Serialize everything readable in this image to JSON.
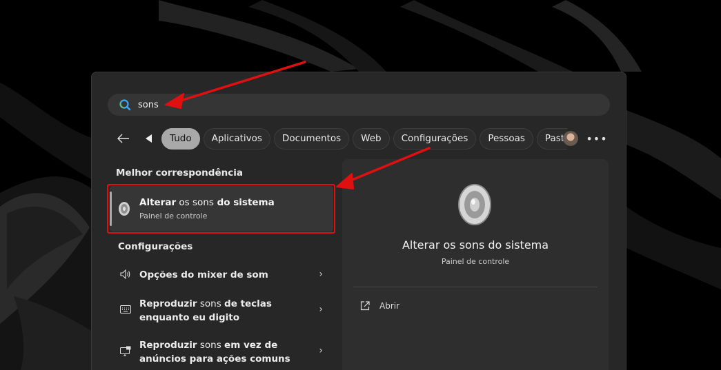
{
  "search": {
    "query": "sons",
    "icon": "search-icon"
  },
  "filters": {
    "chips": [
      "Tudo",
      "Aplicativos",
      "Documentos",
      "Web",
      "Configurações",
      "Pessoas",
      "Pasta"
    ],
    "active": "Tudo"
  },
  "best_match": {
    "heading": "Melhor correspondência",
    "title_bold_1": "Alterar",
    "title_regular_1": " os ",
    "title_regular_2": "sons",
    "title_bold_2": " do sistema",
    "subtitle": "Painel de controle",
    "icon": "speaker-icon"
  },
  "settings": {
    "heading": "Configurações",
    "items": [
      {
        "label": "Opções do mixer de som",
        "icon": "volume-icon"
      },
      {
        "label_a": "Reproduzir",
        "label_b": " sons ",
        "label_c": "de teclas",
        "label_d": "enquanto eu digito",
        "icon": "keyboard-icon"
      },
      {
        "label_a": "Reproduzir",
        "label_b": " sons ",
        "label_c": "em vez de",
        "label_d": "anúncios para ações comuns",
        "icon": "monitor-icon"
      }
    ]
  },
  "detail": {
    "title": "Alterar os sons do sistema",
    "subtitle": "Painel de controle",
    "open_label": "Abrir",
    "icon": "speaker-icon"
  },
  "colors": {
    "highlight": "#e01010",
    "panel": "#272727",
    "detail": "#2e2e2e"
  }
}
